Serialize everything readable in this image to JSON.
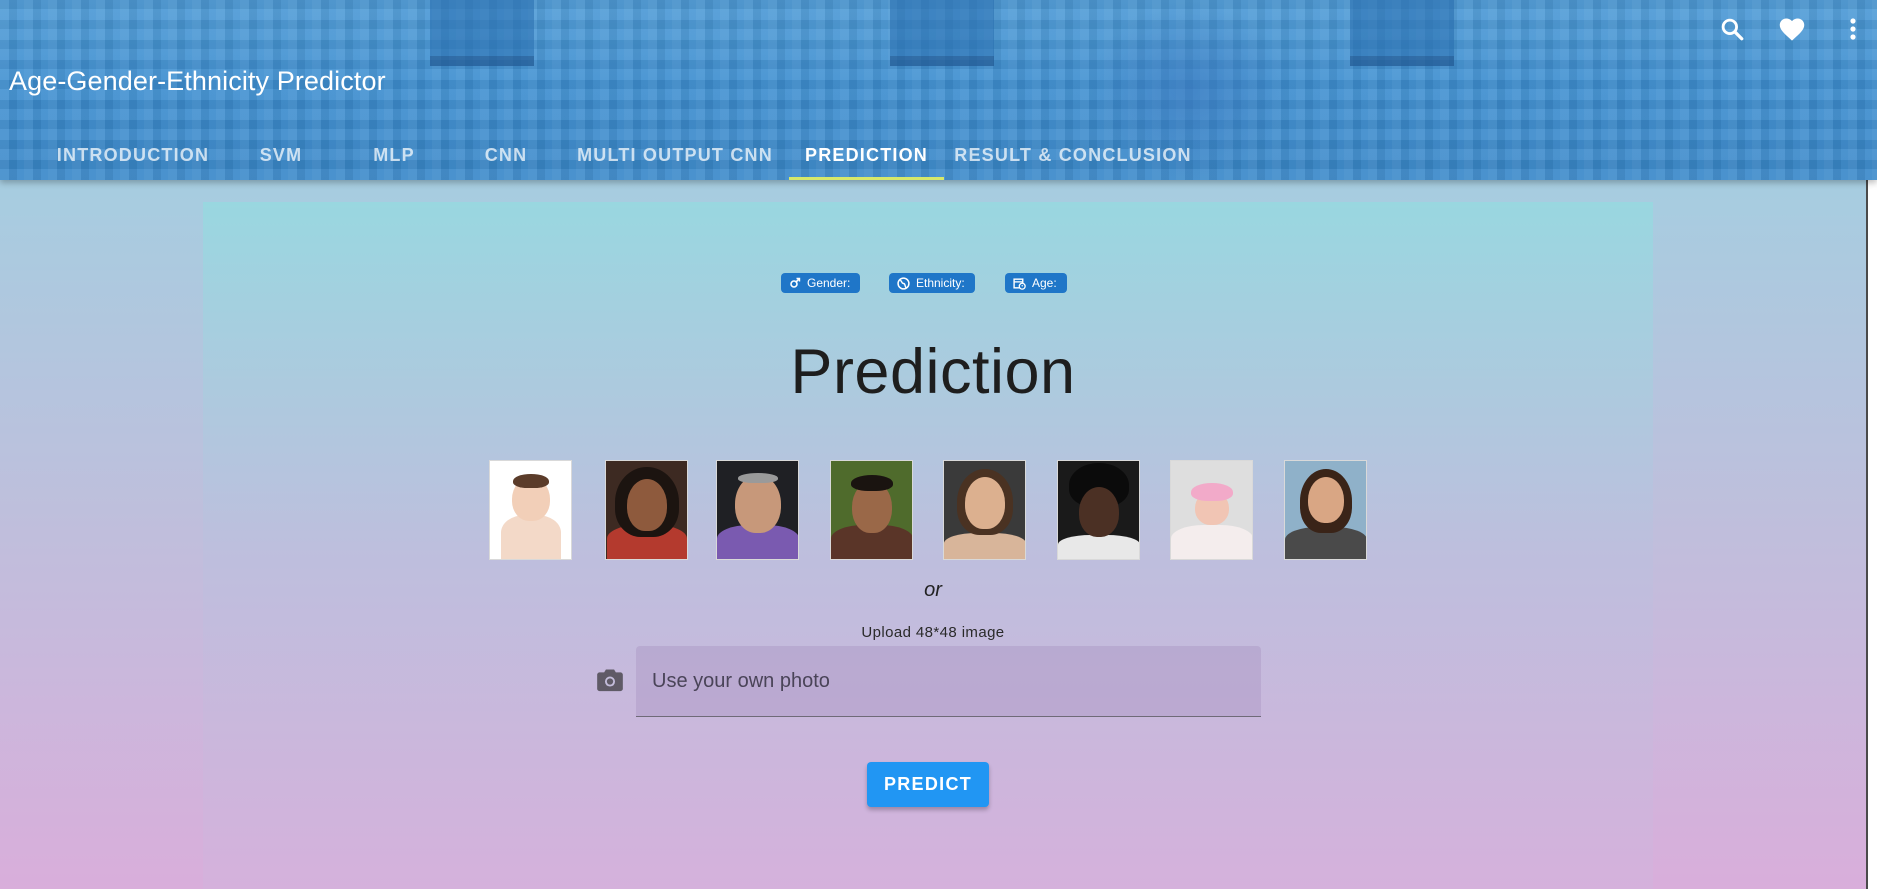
{
  "app": {
    "title": "Age-Gender-Ethnicity Predictor"
  },
  "toolbar_icons": [
    "search-icon",
    "heart-icon",
    "more-vertical-icon"
  ],
  "tabs": [
    {
      "label": "INTRODUCTION",
      "active": false
    },
    {
      "label": "SVM",
      "active": false
    },
    {
      "label": "MLP",
      "active": false
    },
    {
      "label": "CNN",
      "active": false
    },
    {
      "label": "MULTI OUTPUT CNN",
      "active": false
    },
    {
      "label": "PREDICTION",
      "active": true
    },
    {
      "label": "RESULT & CONCLUSION",
      "active": false
    }
  ],
  "chips": {
    "gender": "Gender:",
    "ethnicity": "Ethnicity:",
    "age": "Age:"
  },
  "prediction": {
    "heading": "Prediction",
    "or_text": "or",
    "upload_label": "Upload 48*48 image",
    "file_placeholder": "Use your own photo",
    "predict_label": "PREDICT"
  },
  "sample_images": [
    {
      "name": "baby"
    },
    {
      "name": "young-woman"
    },
    {
      "name": "older-man"
    },
    {
      "name": "young-man"
    },
    {
      "name": "woman"
    },
    {
      "name": "man"
    },
    {
      "name": "infant"
    },
    {
      "name": "middle-aged-woman"
    }
  ],
  "colors": {
    "app_bar": "#3f8fd0",
    "tab_indicator": "#d7e86a",
    "chip": "#1f76c8",
    "predict_button": "#2196f3"
  }
}
